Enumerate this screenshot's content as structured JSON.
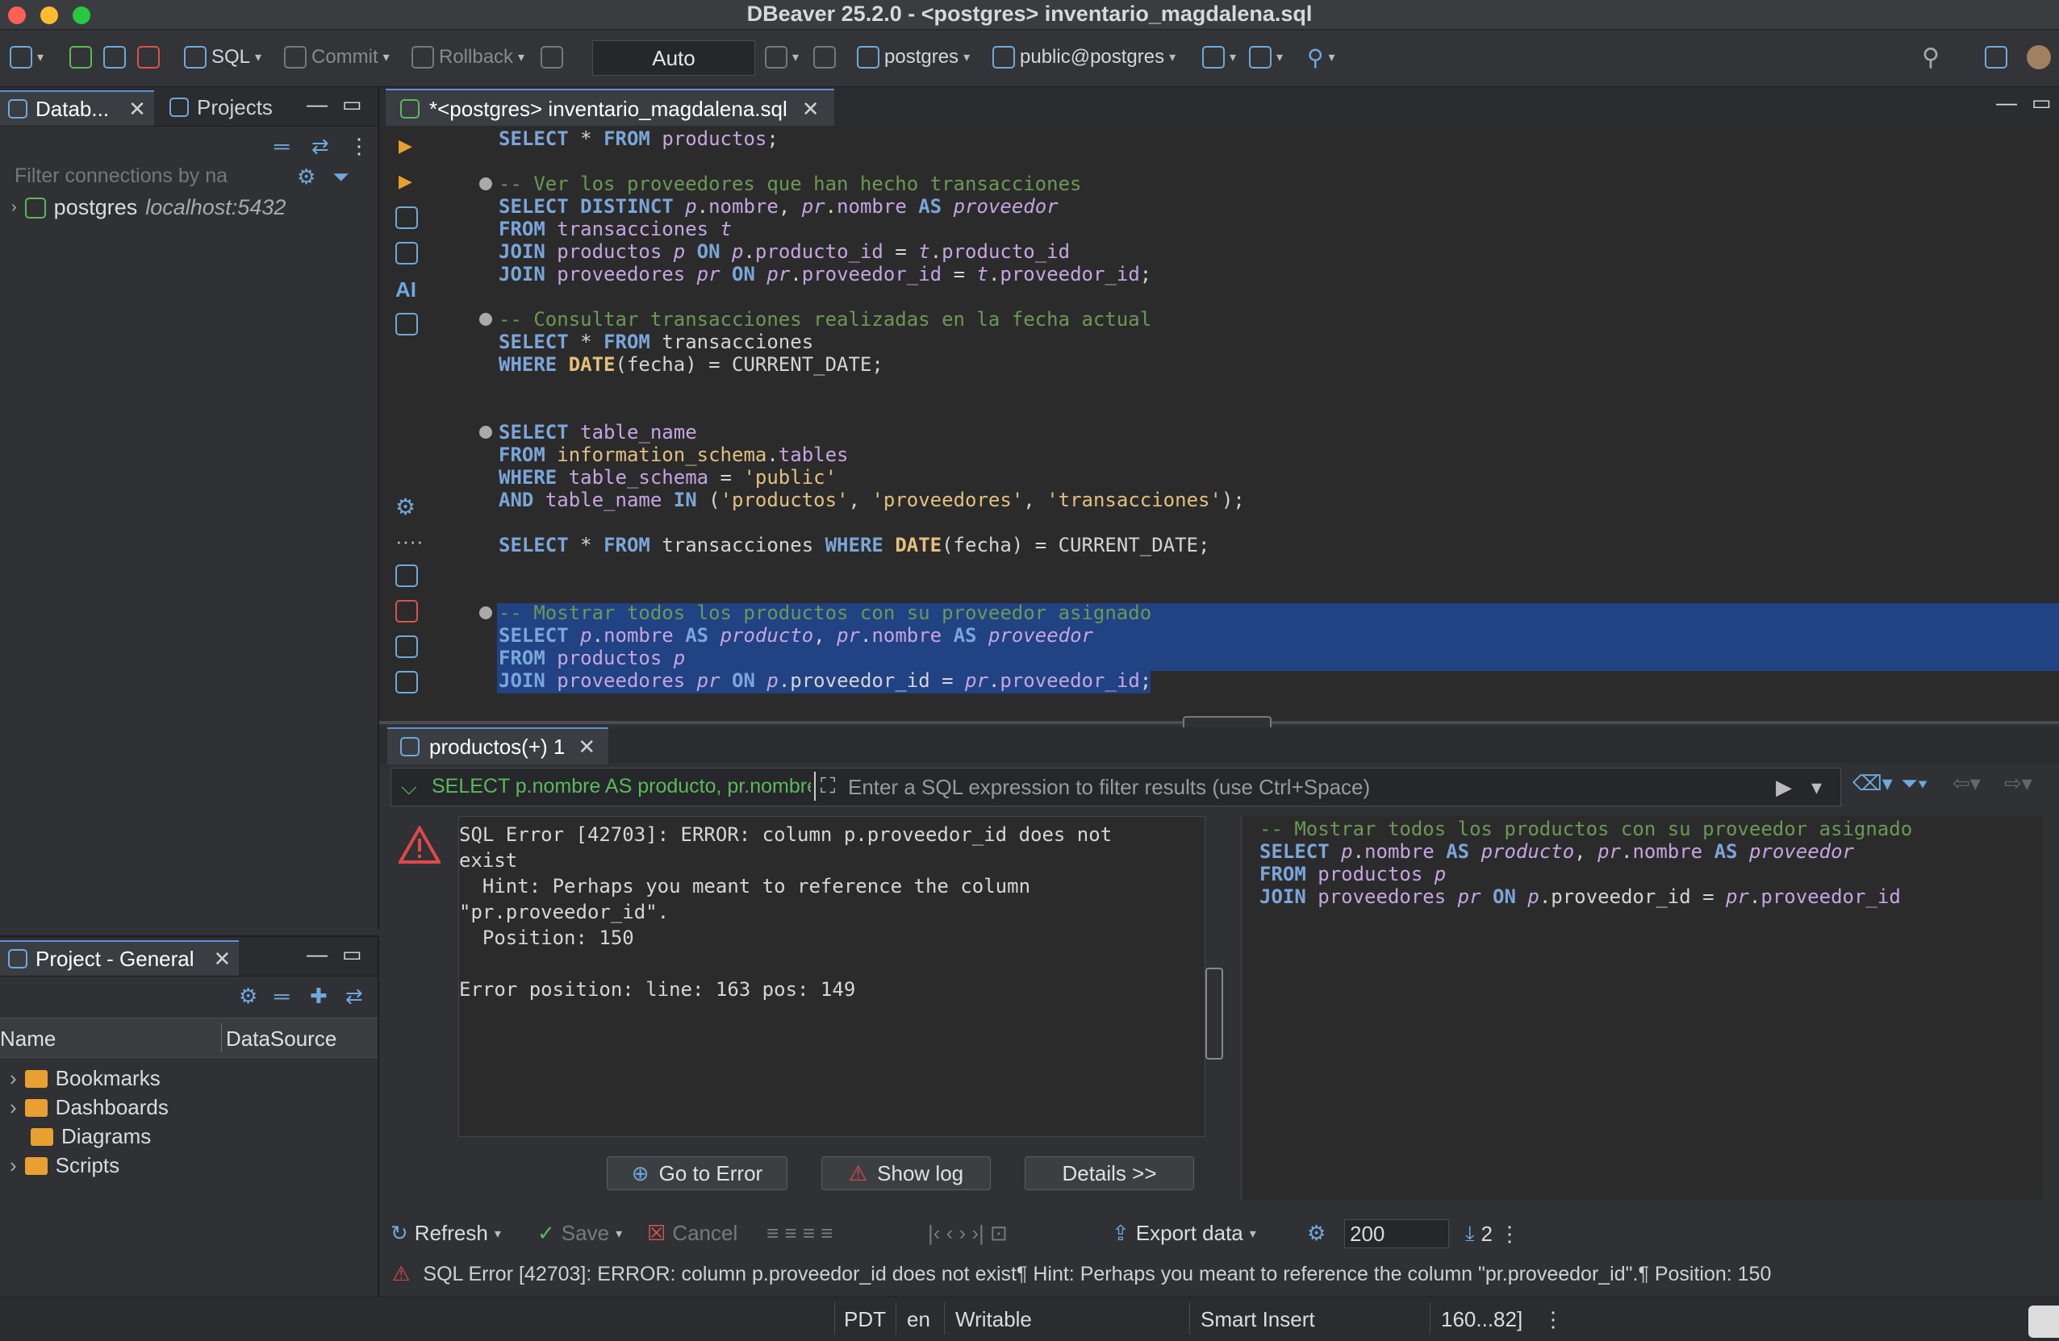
{
  "window": {
    "title": "DBeaver 25.2.0 - <postgres> inventario_magdalena.sql"
  },
  "toolbar": {
    "sql_label": "SQL",
    "commit_label": "Commit",
    "rollback_label": "Rollback",
    "transaction_mode": "Auto",
    "datasource": "postgres",
    "schema": "public@postgres"
  },
  "navigator": {
    "tab_database": "Datab...",
    "tab_projects": "Projects",
    "filter_placeholder": "Filter connections by na",
    "connection_name": "postgres",
    "connection_host": "localhost:5432"
  },
  "project": {
    "tab_label": "Project - General",
    "col_name": "Name",
    "col_datasource": "DataSource",
    "items": [
      {
        "label": "Bookmarks"
      },
      {
        "label": "Dashboards"
      },
      {
        "label": "Diagrams"
      },
      {
        "label": "Scripts"
      }
    ]
  },
  "editor": {
    "tab_label": "*<postgres> inventario_magdalena.sql",
    "ai_label": "AI"
  },
  "code_lines": [
    "SELECT * FROM productos;",
    "",
    "-- Ver los proveedores que han hecho transacciones",
    "SELECT DISTINCT p.nombre, pr.nombre AS proveedor",
    "FROM transacciones t",
    "JOIN productos p ON p.producto_id = t.producto_id",
    "JOIN proveedores pr ON pr.proveedor_id = t.proveedor_id;",
    "",
    "-- Consultar transacciones realizadas en la fecha actual",
    "SELECT * FROM transacciones",
    "WHERE DATE(fecha) = CURRENT_DATE;",
    "",
    "",
    "SELECT table_name",
    "FROM information_schema.tables",
    "WHERE table_schema = 'public'",
    "AND table_name IN ('productos', 'proveedores', 'transacciones');",
    "",
    "SELECT * FROM transacciones WHERE DATE(fecha) = CURRENT_DATE;",
    "",
    "",
    "-- Mostrar todos los productos con su proveedor asignado",
    "SELECT p.nombre AS producto, pr.nombre AS proveedor",
    "FROM productos p",
    "JOIN proveedores pr ON p.proveedor_id = pr.proveedor_id;"
  ],
  "results": {
    "tab_label": "productos(+) 1",
    "filter_query": "SELECT p.nombre AS producto, pr.nombre",
    "filter_placeholder": "Enter a SQL expression to filter results (use Ctrl+Space)",
    "error_text": "SQL Error [42703]: ERROR: column p.proveedor_id does not\nexist\n  Hint: Perhaps you meant to reference the column\n\"pr.proveedor_id\".\n  Position: 150\n\nError position: line: 163 pos: 149",
    "go_to_error": "Go to Error",
    "show_log": "Show log",
    "details": "Details >>",
    "sql_panel_lines": [
      "-- Mostrar todos los productos con su proveedor asignado",
      "SELECT p.nombre AS producto, pr.nombre AS proveedor",
      "FROM productos p",
      "JOIN proveedores pr ON p.proveedor_id = pr.proveedor_id"
    ],
    "refresh": "Refresh",
    "save": "Save",
    "cancel": "Cancel",
    "export": "Export data",
    "max_rows": "200",
    "row_count": "2",
    "status_error": "SQL Error [42703]: ERROR: column p.proveedor_id does not exist¶  Hint: Perhaps you meant to reference the column \"pr.proveedor_id\".¶  Position: 150"
  },
  "statusbar": {
    "timezone": "PDT",
    "locale": "en",
    "mode": "Writable",
    "insert": "Smart Insert",
    "position": "160...82]"
  },
  "colors": {
    "accent": "#5b8fd8",
    "selection": "#214283",
    "keyword": "#7aa6da",
    "comment": "#6a9955"
  }
}
